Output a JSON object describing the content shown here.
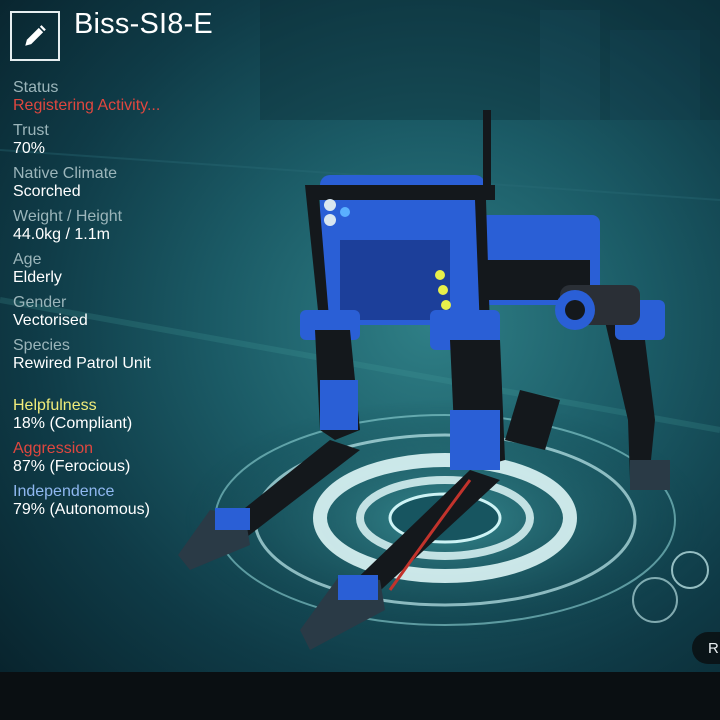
{
  "title": "Biss-SI8-E",
  "icons": {
    "edit": "pencil-icon"
  },
  "stats": [
    {
      "key": "status",
      "label": "Status",
      "value": "Registering Activity..."
    },
    {
      "key": "trust",
      "label": "Trust",
      "value": "70%"
    },
    {
      "key": "climate",
      "label": "Native Climate",
      "value": "Scorched"
    },
    {
      "key": "weight",
      "label": "Weight / Height",
      "value": "44.0kg / 1.1m"
    },
    {
      "key": "age",
      "label": "Age",
      "value": "Elderly"
    },
    {
      "key": "gender",
      "label": "Gender",
      "value": "Vectorised"
    },
    {
      "key": "species",
      "label": "Species",
      "value": "Rewired Patrol Unit"
    }
  ],
  "traits": [
    {
      "key": "helpfulness",
      "label": "Helpfulness",
      "value": "18% (Compliant)",
      "color": "#f0ec7a"
    },
    {
      "key": "aggression",
      "label": "Aggression",
      "value": "87% (Ferocious)",
      "color": "#e0473f"
    },
    {
      "key": "independence",
      "label": "Independence",
      "value": "79% (Autonomous)",
      "color": "#8fb8f0"
    }
  ],
  "corner_button": {
    "label": "R"
  },
  "colors": {
    "robot_blue": "#2a5fd6",
    "robot_black": "#14181c",
    "teal_bg": "#1b5b66",
    "ring": "#dff6f8"
  }
}
